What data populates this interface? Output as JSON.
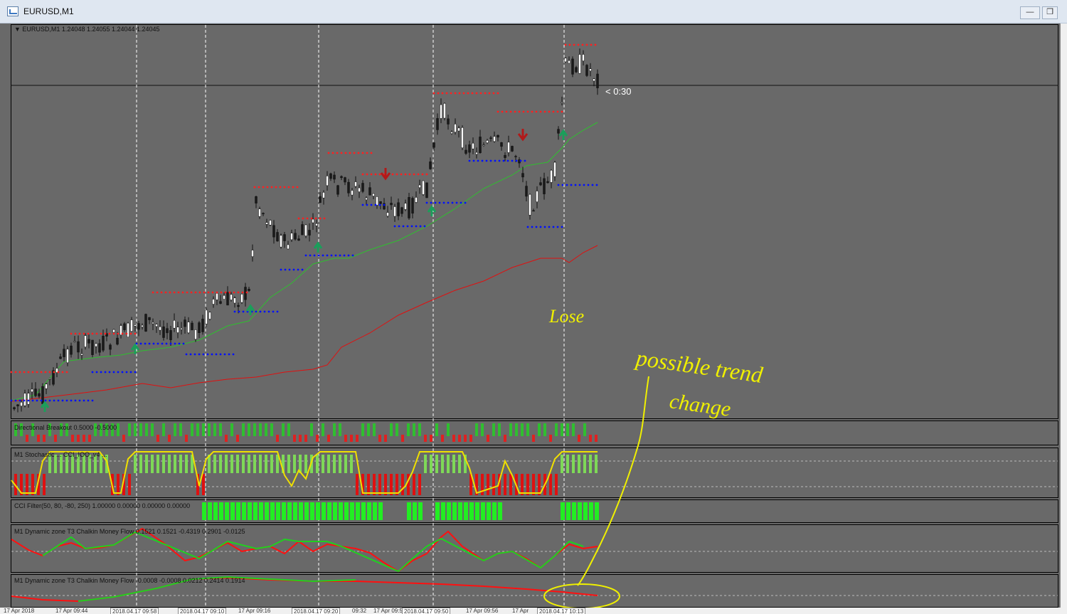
{
  "window": {
    "title": "EURUSD,M1",
    "minimize_glyph": "—",
    "restore_glyph": "❒",
    "close_glyph": "✕"
  },
  "symbol_header": "▼ EURUSD,M1  1.24048 1.24055 1.24044 1.24045",
  "countdown": "< 0:30",
  "panes": {
    "directional": "Directional Breakout 0.5000 -0.5000",
    "stochastic": "M1  Stochastic ... CCI_IOO_v4 ...",
    "cci_filter": "CCI Filter(50, 80, -80, 250) 1.00000 0.00000 0.00000 0.00000",
    "chaikin1": "M1 Dynamic zone T3 Chalkin Money Flow  0.1521 0.1521 -0.4319 0.2901 -0.0125",
    "chaikin2": "M1 Dynamic zone T3 Chalkin Money Flow  -0.0008 -0.0008 0.0212 0.2414 0.1914"
  },
  "annotations": {
    "lose": "Lose",
    "trend1": "possible trend",
    "trend2": "change"
  },
  "time_labels": [
    "17 Apr 2018",
    "17 Apr 09:44",
    "2018.04.17 09:58",
    "2018.04.17 09:10",
    "17 Apr 09:16",
    "2018.04.17 09:20",
    "09:32",
    "17 Apr 09:50",
    "2018.04.17 09:50",
    "17 Apr 09:56",
    "17 Apr",
    "2018.04.17 10:13"
  ],
  "colors": {
    "background": "#696969",
    "bull": "#ffffff",
    "bear": "#1a1a1a",
    "resistance": "#ff2020",
    "support": "#0010ff",
    "ma_fast": "#2fbf2f",
    "ma_slow": "#e01010",
    "annotation": "#f0f000"
  }
}
